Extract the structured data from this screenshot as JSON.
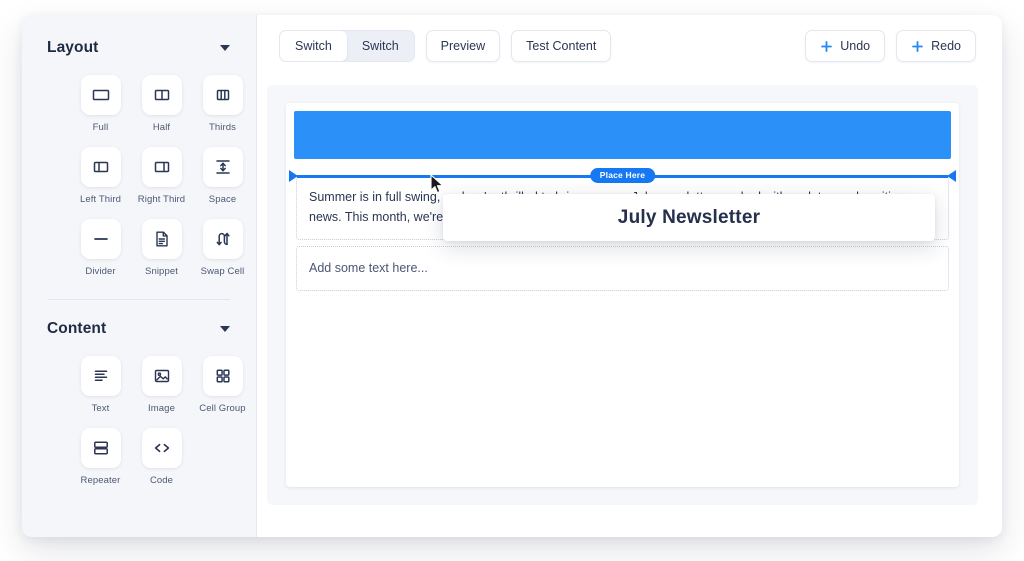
{
  "sidebar": {
    "sections": [
      {
        "title": "Layout",
        "caret_icon": "chevron-down-icon",
        "items": [
          {
            "label": "Full",
            "icon": "layout-full-icon"
          },
          {
            "label": "Half",
            "icon": "layout-half-icon"
          },
          {
            "label": "Thirds",
            "icon": "layout-thirds-icon"
          },
          {
            "label": "Left Third",
            "icon": "layout-left-third-icon"
          },
          {
            "label": "Right Third",
            "icon": "layout-right-third-icon"
          },
          {
            "label": "Space",
            "icon": "space-icon"
          },
          {
            "label": "Divider",
            "icon": "divider-icon"
          },
          {
            "label": "Snippet",
            "icon": "snippet-icon"
          },
          {
            "label": "Swap Cell",
            "icon": "swap-cell-icon"
          }
        ]
      },
      {
        "title": "Content",
        "caret_icon": "chevron-down-icon",
        "items": [
          {
            "label": "Text",
            "icon": "text-icon"
          },
          {
            "label": "Image",
            "icon": "image-icon"
          },
          {
            "label": "Cell Group",
            "icon": "cell-group-icon"
          },
          {
            "label": "Repeater",
            "icon": "repeater-icon"
          },
          {
            "label": "Code",
            "icon": "code-icon"
          }
        ]
      }
    ]
  },
  "toolbar": {
    "segmented": {
      "options": [
        "Switch",
        "Switch"
      ],
      "selected_index": 0
    },
    "preview_label": "Preview",
    "test_content_label": "Test Content",
    "undo_label": "Undo",
    "redo_label": "Redo",
    "plus_icon": "plus-icon",
    "accent_color": "#2589f5"
  },
  "canvas": {
    "hero_banner_color": "#2b90f7",
    "drop_indicator": {
      "label": "Place Here",
      "color": "#1678f2"
    },
    "cells": [
      {
        "name": "body-text-cell",
        "text": "Summer is in full swing, and we're thrilled to bring you our July newsletter, packed with updates and exciting news. This month, we're highlighting the latest happenings, events, and opportunities in our vibrant community."
      },
      {
        "name": "empty-text-cell",
        "text": "Add some text here..."
      }
    ]
  },
  "drag_ghost": {
    "title": "July Newsletter"
  }
}
